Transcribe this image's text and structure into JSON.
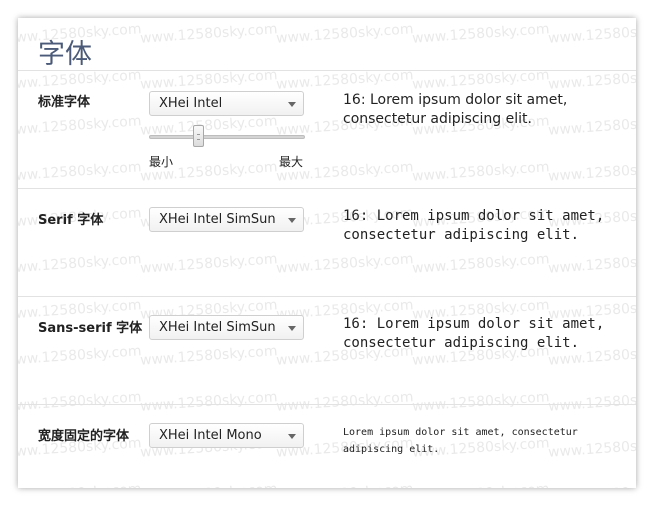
{
  "page": {
    "title": "字体"
  },
  "watermark": "www.12580sky.com",
  "sections": {
    "standard": {
      "label": "标准字体",
      "font_value": "XHei Intel",
      "size": {
        "min_label": "最小",
        "max_label": "最大",
        "level": 0.3
      },
      "preview": "16: Lorem ipsum dolor sit amet, consectetur adipiscing elit."
    },
    "serif": {
      "label": "Serif 字体",
      "font_value": "XHei Intel SimSun",
      "preview": "16: Lorem ipsum dolor sit amet, consectetur adipiscing elit."
    },
    "sans_serif": {
      "label": "Sans-serif 字体",
      "font_value": "XHei Intel SimSun",
      "preview": "16: Lorem ipsum dolor sit amet, consectetur adipiscing elit."
    },
    "fixed_width": {
      "label": "宽度固定的字体",
      "font_value": "XHei Intel Mono",
      "preview": "Lorem ipsum dolor sit amet, consectetur adipiscing elit."
    }
  },
  "icons": {
    "dropdown": "chevron-down-icon",
    "slider": "slider-thumb-icon"
  }
}
